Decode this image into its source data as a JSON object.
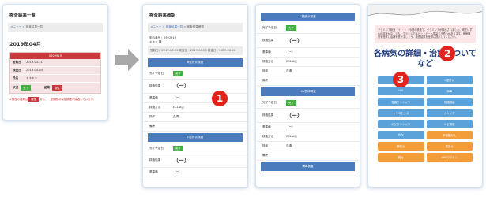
{
  "s1": {
    "title": "検査結果一覧",
    "crumb_home": "メニュー",
    "crumb_current": " > 検査結果一覧",
    "month": "2019年04月",
    "order_no": "0922919",
    "rows": [
      {
        "k": "受取日",
        "v": "2019-03-31"
      },
      {
        "k": "検査日",
        "v": "2019-04-04"
      },
      {
        "k": "氏名",
        "v": "＊＊＊＊"
      }
    ],
    "status_label": "状況",
    "status_done": "完了",
    "result_label": "結果",
    "result_value": "陽性",
    "note_a": "※陽性の結果は",
    "note_badge": "陽性",
    "note_b": "また、一定期間の保存期限が経過しています。"
  },
  "s2": {
    "title": "検査結果確認",
    "crumb_home": "メニュー",
    "crumb_mid": " > 検査結果一覧",
    "crumb_current": " > 検査結果確認",
    "meta": [
      "申込番号：0922919",
      "＊＊＊ 様"
    ],
    "dates": "受取日：2019-03-31  検査日：2019-04-03  検査日：2019-04-04",
    "section_a": "B型肝炎検査",
    "section_b": "C型肝炎検査",
    "labels": {
      "done": "完了予定日",
      "result": "検査結果",
      "standard": "基準値",
      "method": "検査方法",
      "body": "検体",
      "remark": "備考"
    },
    "done_badge": "完了",
    "result_value": "（ー）",
    "standard_value": "（ー）",
    "method_value": "ECLIA法",
    "body_value": "血清"
  },
  "s3": {
    "section_a": "C型肝炎検査",
    "section_b": "HIV抗体検査",
    "section_c": "梅毒検査",
    "labels": {
      "done": "完了予定日",
      "result": "検査結果",
      "standard": "基準値",
      "method": "検査方法",
      "body": "検体",
      "remark": "備考"
    },
    "done_badge": "完了",
    "result_value": "（ー）",
    "standard_value": "（ー）",
    "method_value": "ECLIA法",
    "body_value": "血清"
  },
  "s4": {
    "pink_text": "クラミジア検査（＋）・・・今回の検査で、クラミジアが検出されました。現在いずれの症状がなくても、クラミジアはパートナーへ感染する恐れがあります。医療機関を受診し治療を受けましょう。検査結果を医師に提示してください。",
    "heading": "各病気の詳細・治療について など",
    "tiles": [
      {
        "label": "B型肝炎",
        "tone": "blue"
      },
      {
        "label": "C型肝炎",
        "tone": "blue"
      },
      {
        "label": "HIV",
        "tone": "blue"
      },
      {
        "label": "梅毒",
        "tone": "blue"
      },
      {
        "label": "性器クラミジア",
        "tone": "blue"
      },
      {
        "label": "咽頭淋菌",
        "tone": "blue"
      },
      {
        "label": "トリコモナス",
        "tone": "blue"
      },
      {
        "label": "カンジダ",
        "tone": "blue"
      },
      {
        "label": "のどクラミジア",
        "tone": "blue"
      },
      {
        "label": "のど淋菌",
        "tone": "blue"
      },
      {
        "label": "HPV",
        "tone": "blue"
      },
      {
        "label": "子宮頸がん",
        "tone": "orange"
      },
      {
        "label": "膀胱炎",
        "tone": "orange"
      },
      {
        "label": "尿道炎",
        "tone": "orange"
      },
      {
        "label": "膣炎",
        "tone": "orange"
      },
      {
        "label": "HPVワクチン",
        "tone": "orange"
      }
    ]
  },
  "markers": [
    "1",
    "2",
    "3"
  ],
  "colors": {
    "primary": "#4a7bbd",
    "alert": "#c53b3b",
    "ok": "#3db03d",
    "marker": "#e0241b"
  }
}
